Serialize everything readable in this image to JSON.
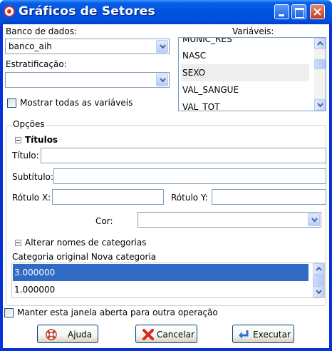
{
  "window": {
    "title": "Gráficos de Setores"
  },
  "database": {
    "label": "Banco de dados:",
    "value": "banco_aih"
  },
  "stratification": {
    "label": "Estratificação:",
    "value": ""
  },
  "variables": {
    "label": "Variáveis:",
    "items": [
      "MUNIC_RES",
      "NASC",
      "SEXO",
      "VAL_SANGUE",
      "VAL_TOT"
    ],
    "selected": "SEXO"
  },
  "show_all": {
    "label": "Mostrar todas as variáveis",
    "checked": false
  },
  "options": {
    "label": "Opções",
    "titles_section": "Títulos",
    "title_label": "Título:",
    "subtitle_label": "Subtítulo:",
    "xlabel_label": "Rótulo X:",
    "ylabel_label": "Rótulo Y:",
    "color_label": "Cor:",
    "color_value": ""
  },
  "categories": {
    "section": "Alterar nomes de categorias",
    "header": "Categoria original Nova categoria",
    "rows": [
      "3.000000",
      "1.000000"
    ],
    "selected": "3.000000"
  },
  "keep_open": {
    "label": "Manter esta janela aberta para outra operação",
    "checked": false
  },
  "buttons": {
    "help": "Ajuda",
    "cancel": "Cancelar",
    "execute": "Executar"
  },
  "colors": {
    "titlebar": "#0054e3",
    "selection": "#316ac5",
    "border": "#7f9db9"
  }
}
